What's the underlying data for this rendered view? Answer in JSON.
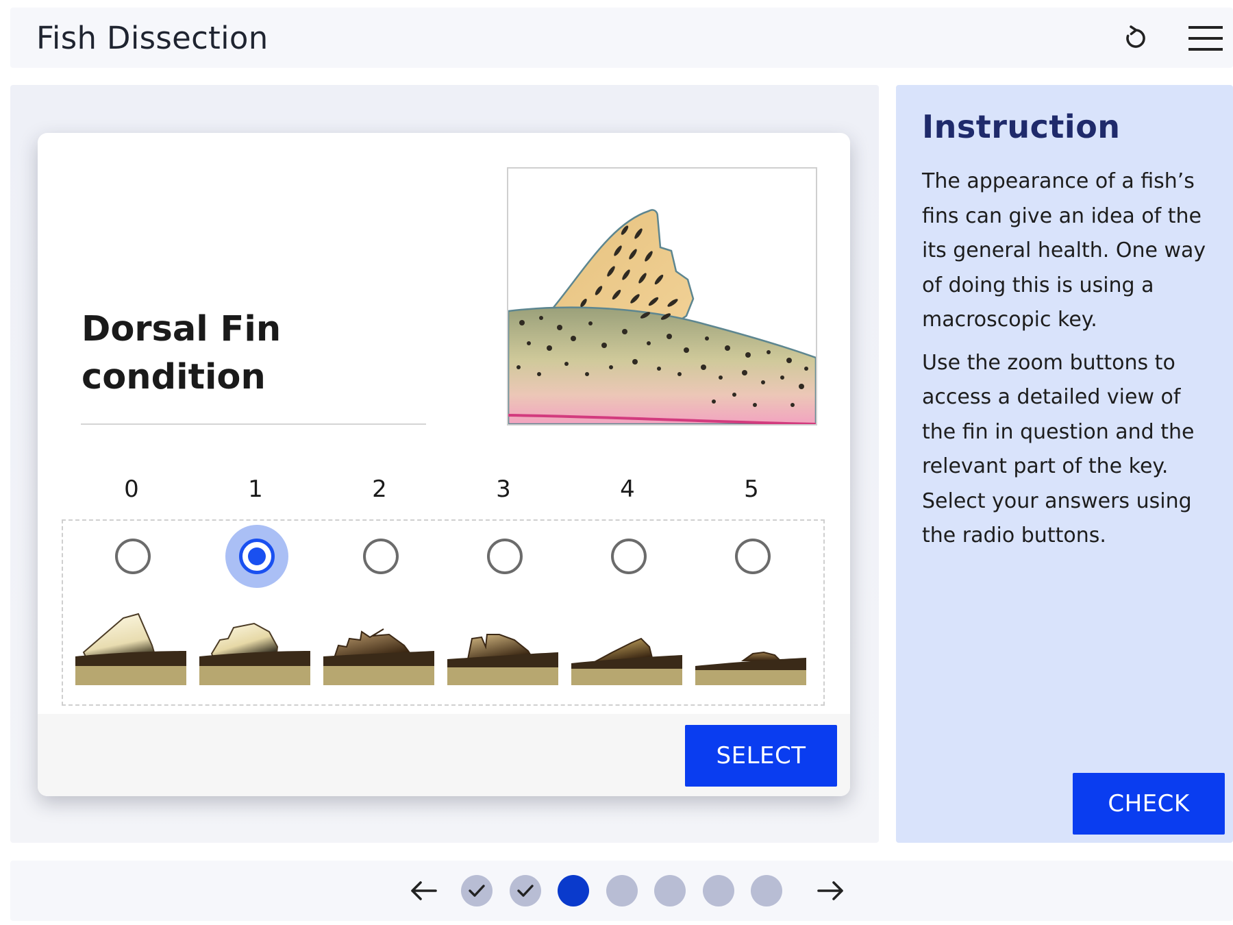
{
  "header": {
    "title": "Fish Dissection",
    "restart_icon": "restart-icon",
    "menu_icon": "hamburger-menu-icon"
  },
  "card": {
    "title_line1": "Dorsal Fin",
    "title_line2": "condition",
    "image_icon": "dorsal-fin-illustration",
    "scale": [
      {
        "label": "0",
        "selected": false
      },
      {
        "label": "1",
        "selected": true
      },
      {
        "label": "2",
        "selected": false
      },
      {
        "label": "3",
        "selected": false
      },
      {
        "label": "4",
        "selected": false
      },
      {
        "label": "5",
        "selected": false
      }
    ],
    "select_label": "SELECT"
  },
  "instruction": {
    "title": "Instruction",
    "paragraph1": "The appearance of a fish’s fins can give an idea of the its general health. One way of doing this is using a macroscopic key.",
    "paragraph2": "Use the zoom buttons to access a detailed view of the fin in question and the relevant part of the key. Select your answers using the radio buttons.",
    "check_label": "CHECK"
  },
  "navigation": {
    "prev_icon": "arrow-left-icon",
    "next_icon": "arrow-right-icon",
    "steps": [
      {
        "state": "completed"
      },
      {
        "state": "completed"
      },
      {
        "state": "current"
      },
      {
        "state": "pending"
      },
      {
        "state": "pending"
      },
      {
        "state": "pending"
      },
      {
        "state": "pending"
      }
    ]
  },
  "colors": {
    "primary_button": "#0a3df0",
    "instruction_bg": "#d9e3fb",
    "instruction_title": "#1f2a6b",
    "radio_selected": "#1a50f0",
    "radio_halo": "#aabff5",
    "nav_current": "#0a3acc",
    "nav_other": "#b8bdd4"
  }
}
